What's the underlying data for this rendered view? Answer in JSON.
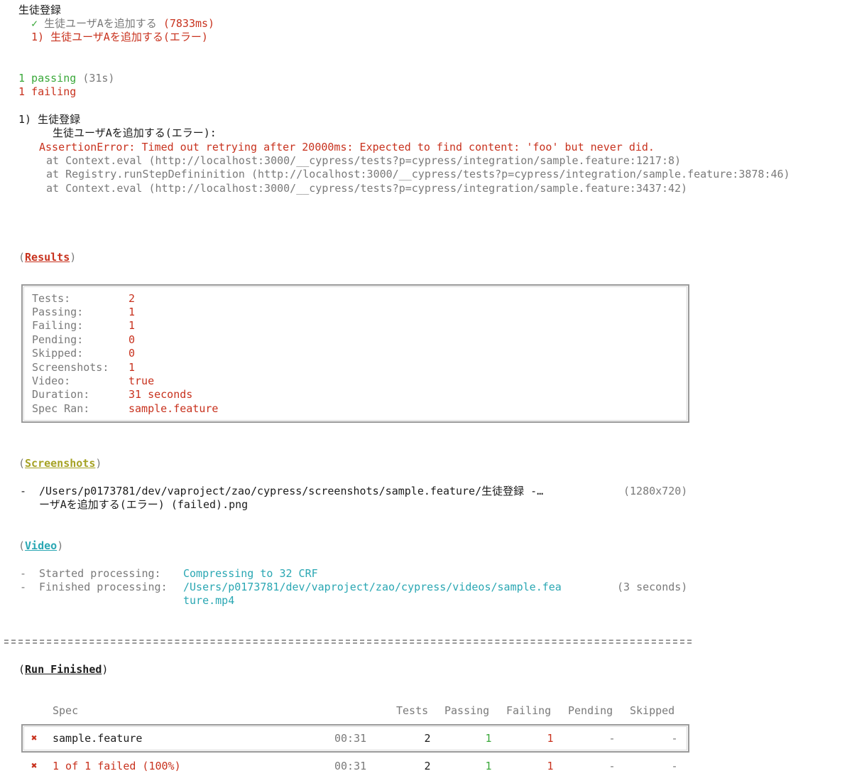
{
  "suite": {
    "title": "生徒登録",
    "pass_check": "✓",
    "pass_test_name": "生徒ユーザAを追加する",
    "pass_duration": "(7833ms)",
    "fail_line": "1) 生徒ユーザAを追加する(エラー)"
  },
  "summary": {
    "passing_count": "1 passing",
    "passing_time": "(31s)",
    "failing_count": "1 failing"
  },
  "error": {
    "heading": "1) 生徒登録",
    "test_line": "生徒ユーザAを追加する(エラー):",
    "message": "AssertionError: Timed out retrying after 20000ms: Expected to find content: 'foo' but never did.",
    "stack": [
      "at Context.eval (http://localhost:3000/__cypress/tests?p=cypress/integration/sample.feature:1217:8)",
      "at Registry.runStepDefininition (http://localhost:3000/__cypress/tests?p=cypress/integration/sample.feature:3878:46)",
      "at Context.eval (http://localhost:3000/__cypress/tests?p=cypress/integration/sample.feature:3437:42)"
    ]
  },
  "results": {
    "heading": "Results",
    "rows": [
      {
        "label": "Tests:",
        "value": "2"
      },
      {
        "label": "Passing:",
        "value": "1"
      },
      {
        "label": "Failing:",
        "value": "1"
      },
      {
        "label": "Pending:",
        "value": "0"
      },
      {
        "label": "Skipped:",
        "value": "0"
      },
      {
        "label": "Screenshots:",
        "value": "1"
      },
      {
        "label": "Video:",
        "value": "true"
      },
      {
        "label": "Duration:",
        "value": "31 seconds"
      },
      {
        "label": "Spec Ran:",
        "value": "sample.feature"
      }
    ]
  },
  "screenshots": {
    "heading": "Screenshots",
    "bullet": "-",
    "path_line1": "/Users/p0173781/dev/vaproject/zao/cypress/screenshots/sample.feature/生徒登録 -…",
    "path_line2": "ーザAを追加する(エラー) (failed).png",
    "size": "(1280x720)"
  },
  "video": {
    "heading": "Video",
    "bullet": "-",
    "started_label": "Started processing:",
    "started_value": "Compressing to 32 CRF",
    "finished_label": "Finished processing:",
    "finished_value_line1": "/Users/p0173781/dev/vaproject/zao/cypress/videos/sample.fea",
    "finished_value_line2": "ture.mp4",
    "finished_time": "(3 seconds)"
  },
  "separator": "====================================================================================================",
  "run_finished": {
    "heading": "Run Finished",
    "columns": {
      "spec": "Spec",
      "tests": "Tests",
      "passing": "Passing",
      "failing": "Failing",
      "pending": "Pending",
      "skipped": "Skipped"
    },
    "row": {
      "icon": "✖",
      "spec": "sample.feature",
      "time": "00:31",
      "tests": "2",
      "passing": "1",
      "failing": "1",
      "pending": "-",
      "skipped": "-"
    },
    "total": {
      "icon": "✖",
      "label": "1 of 1 failed (100%)",
      "time": "00:31",
      "tests": "2",
      "passing": "1",
      "failing": "1",
      "pending": "-",
      "skipped": "-"
    }
  },
  "colors": {
    "red": "#c8321e",
    "green": "#3aa83a",
    "gray": "#7a7a7a",
    "olive": "#a6a224",
    "cyan": "#2aa7b3"
  }
}
